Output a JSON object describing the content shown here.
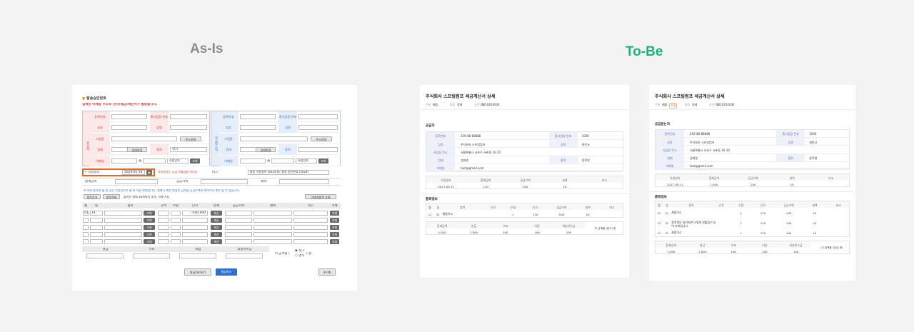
{
  "headings": {
    "asis": "As-Is",
    "tobe": "To-Be"
  },
  "colors": {
    "tobe_green": "#1db07d",
    "asis_gray": "#8c8c8c",
    "red": "#d52b2b",
    "blue": "#2f6fd0",
    "highlight": "#e8681e"
  },
  "asis": {
    "title": "발송승인번호",
    "notice": "입력한 이메일 주소로 전자(세금)계산서가 발송됩니다.",
    "supplier_side": "공급자",
    "buyer_side": "공급받는자",
    "labels": {
      "reg_no": "등록번호",
      "sub_no": "종사업장 번호",
      "name": "상호",
      "rep": "성명",
      "addr": "사업장",
      "biz": "업태",
      "item": "종목",
      "email": "이메일"
    },
    "values": {
      "type_value": "작가",
      "select": "직접입력"
    },
    "buttons": {
      "addr_search": "주소변경",
      "biz_change": "업태변경",
      "lookup": "조회",
      "calc": "계산",
      "del": "삭제",
      "add_item": "품목추가",
      "del_item": "품목삭제",
      "trade_lookup": "거래처품목 조회",
      "preview": "발급미리보기",
      "issue": "발급하기",
      "reset": "초기화"
    },
    "write_date_label": "작성일자",
    "write_date_value": "2024-01-14",
    "date_warning": "작성일자는 공급 연월일을 의미함",
    "remark_label": "비고",
    "remark_value": "발송 작성일자 (2024.0), 발송 승인번호 (2024)",
    "sum_label": "합계금액",
    "supply_label": "공급가액",
    "tax_label": "세액",
    "info_line1": "※ 아래 품목의 월 일 공란 작성일자가 월 와 자동 반영됩니다. 발행시 계산 변경된 금액을 공급가액과 세액으로 계산 할 수 있습니다.",
    "info_line2": "품목은 최대 16개까지 추가, 삭제 가능",
    "grid_headers": [
      "월",
      "일",
      "품목",
      "규격",
      "수량",
      "단가",
      "합계",
      "공급가액",
      "세액",
      "비고",
      "삭제"
    ],
    "grid_first_row": {
      "month": "01",
      "day": "14",
      "unit_price": "-500,000"
    },
    "payment_headers": [
      "현금",
      "수표",
      "어음",
      "외상미수금"
    ],
    "payment_mode_prefix": "이 금액을 (",
    "payment_mode_opt1": "청구",
    "payment_mode_opt2": "영수",
    "payment_mode_suffix": ") 함"
  },
  "tobe1": {
    "title": "주식회사 스프링컴프 세금계산서 상세",
    "meta": [
      {
        "k": "구분",
        "v": "매입"
      },
      {
        "k": "종류",
        "v": "정세"
      },
      {
        "k": "승인번호",
        "v": "1010203030"
      }
    ],
    "section_supplier": "공급자",
    "rows": [
      {
        "l1": "등록번호",
        "v1": "256-88-88888",
        "l2": "종사업장 번호",
        "v2": "1000"
      },
      {
        "l1": "상호",
        "v1": "주식회사 스프링컴프",
        "l2": "성명",
        "v2": "최민교"
      },
      {
        "l1": "사업장 주소",
        "v1": "서울특별시 서초구 서초동 10-10",
        "l2": "",
        "v2": ""
      },
      {
        "l1": "업태",
        "v1": "업태명",
        "l2": "종목",
        "v2": "종목명"
      },
      {
        "l1": "이메일",
        "v1": "test@gmail.com",
        "l2": "",
        "v2": ""
      }
    ],
    "summary_headers": [
      "작성일자",
      "합계금액",
      "공급가액",
      "세액",
      "비고"
    ],
    "summary_values": [
      "2017-09-11",
      "110",
      "100",
      "10",
      ""
    ],
    "section_items": "품목정보",
    "item_headers": [
      "월",
      "일",
      "품목",
      "규격",
      "수량",
      "단가",
      "공급가액",
      "세액",
      "비고"
    ],
    "items": [
      {
        "m": "12",
        "d": "31",
        "name": "제품이소",
        "spec": "",
        "qty": "1",
        "price": "110",
        "supply": "100",
        "tax": "10",
        "note": ""
      }
    ],
    "pay_headers": [
      "합계금액",
      "현금",
      "수표",
      "어음",
      "외상미수금"
    ],
    "pay_values": [
      "1,000",
      "1,000",
      "100",
      "100",
      "100"
    ],
    "pay_note": "이 금액을 (청구) 함"
  },
  "tobe2": {
    "title": "주식회사 스프링컴프 세금계산서 상세",
    "meta": [
      {
        "k": "구분",
        "v": "매출"
      },
      {
        "k": "종류",
        "v": "정세"
      },
      {
        "k": "승인번호",
        "v": "1010203030"
      }
    ],
    "meta_badge": "수정",
    "section_supplier": "공급받는자",
    "rows": [
      {
        "l1": "등록번호",
        "v1": "256-88-88888",
        "l2": "종사업장 번호",
        "v2": "1000"
      },
      {
        "l1": "상호",
        "v1": "주식회사 스프링컴프",
        "l2": "성명",
        "v2": "최민교"
      },
      {
        "l1": "사업장 주소",
        "v1": "서울특별시 서초구 서초동 10-10",
        "l2": "",
        "v2": ""
      },
      {
        "l1": "업태",
        "v1": "업태명",
        "l2": "종목",
        "v2": "종목명"
      },
      {
        "l1": "이메일",
        "v1": "test@gmail.com",
        "l2": "",
        "v2": ""
      }
    ],
    "summary_headers": [
      "작성일자",
      "합계금액",
      "공급가액",
      "세액",
      "비고"
    ],
    "summary_values": [
      "2017-09-11",
      "1,000",
      "100",
      "10",
      ""
    ],
    "section_items": "품목정보",
    "item_headers": [
      "월",
      "일",
      "품목",
      "규격",
      "수량",
      "단가",
      "공급가액",
      "세액",
      "비고"
    ],
    "items": [
      {
        "m": "12",
        "d": "31",
        "name": "제품이소",
        "spec": "",
        "qty": "1",
        "price": "110",
        "supply": "100",
        "tax": "10",
        "note": ""
      },
      {
        "m": "12",
        "d": "31",
        "name": "품목명이 길어지면 이렇게 말줄임이 되어 보여집니다.",
        "spec": "",
        "qty": "1",
        "price": "110",
        "supply": "100",
        "tax": "10",
        "note": ""
      },
      {
        "m": "12",
        "d": "31",
        "name": "제품이소",
        "spec": "",
        "qty": "1",
        "price": "110",
        "supply": "100",
        "tax": "10",
        "note": ""
      }
    ],
    "pay_headers": [
      "합계금액",
      "현금",
      "수표",
      "어음",
      "외상미수금"
    ],
    "pay_values": [
      "1,000",
      "1,000",
      "100",
      "100",
      "100"
    ],
    "pay_note": "이 금액을 (영수) 함"
  }
}
